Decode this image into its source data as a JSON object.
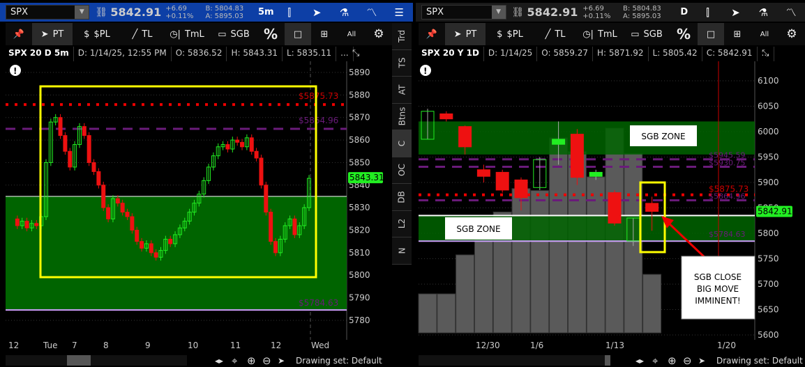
{
  "left": {
    "symbol": "SPX",
    "last": "5842.91",
    "change": "+6.69",
    "change_pct": "+0.11%",
    "bid": "B: 5804.83",
    "ask": "A: 5895.03",
    "timeframe": "5m",
    "tools": [
      "PT",
      "$PL",
      "TL",
      "TmL",
      "SGB",
      "%",
      "All"
    ],
    "info": [
      "SPX 20 D 5m",
      "D: 1/14/25, 12:55 PM",
      "O: 5836.52",
      "H: 5843.31",
      "L: 5835.11",
      "..."
    ],
    "side_tabs": [
      "Trd",
      "TS",
      "AT",
      "Btns",
      "C",
      "OC",
      "DB",
      "L2",
      "N"
    ],
    "price_ticks": [
      "5890",
      "5880",
      "5870",
      "5860",
      "5850",
      "5840",
      "5830",
      "5820",
      "5810",
      "5800",
      "5790",
      "5780"
    ],
    "price_tag": "5843.31",
    "levels": {
      "red": "$5875.73",
      "purple": "$5864.96",
      "low": "$5784.63"
    },
    "time_ticks": [
      "12",
      "Tue",
      "7",
      "8",
      "9",
      "10",
      "11",
      "12",
      "Wed"
    ],
    "drawing_set": "Drawing set: Default"
  },
  "right": {
    "symbol": "SPX",
    "last": "5842.91",
    "change": "+6.69",
    "change_pct": "+0.11%",
    "bid": "B: 5804.83",
    "ask": "A: 5895.03",
    "timeframe": "D",
    "tools": [
      "PT",
      "$PL",
      "TL",
      "TmL",
      "SGB",
      "%",
      "All"
    ],
    "info": [
      "SPX 20 Y 1D",
      "D: 1/14/25",
      "O: 5859.27",
      "H: 5871.92",
      "L: 5805.42",
      "C: 5842.91",
      "..."
    ],
    "price_ticks": [
      "6100",
      "6050",
      "6000",
      "5950",
      "5900",
      "5850",
      "5800",
      "5750",
      "5700",
      "5650",
      "5600"
    ],
    "price_tag": "5842.91",
    "levels": {
      "l1": "$5945.59",
      "l2": "$5930.75",
      "red": "$5875.73",
      "purple": "$5864.96",
      "low": "$5784.63"
    },
    "zone_upper": "SGB ZONE",
    "zone_lower": "SGB ZONE",
    "callout": "SGB CLOSE BIG MOVE IMMINENT!",
    "time_ticks": [
      "12/30",
      "1/6",
      "1/13",
      "1/20"
    ],
    "drawing_set": "Drawing set: Default"
  },
  "colors": {
    "up": "#22ee22",
    "down": "#ee1111",
    "zone": "#006400",
    "yellow": "#ffff00",
    "purple": "#6a1b7a"
  },
  "chart_data": [
    {
      "type": "candlestick",
      "title": "SPX 20 D 5m",
      "ylim": [
        5777,
        5895
      ],
      "closes": [
        5825,
        5822,
        5824,
        5821,
        5823,
        5822,
        5826,
        5850,
        5868,
        5870,
        5862,
        5855,
        5848,
        5858,
        5866,
        5862,
        5850,
        5846,
        5840,
        5830,
        5825,
        5834,
        5832,
        5828,
        5826,
        5820,
        5815,
        5812,
        5814,
        5810,
        5808,
        5811,
        5816,
        5814,
        5818,
        5821,
        5824,
        5828,
        5832,
        5836,
        5842,
        5848,
        5853,
        5857,
        5858,
        5856,
        5860,
        5859,
        5857,
        5861,
        5855,
        5852,
        5840,
        5828,
        5815,
        5810,
        5816,
        5822,
        5825,
        5818,
        5822,
        5830,
        5843
      ]
    },
    {
      "type": "candlestick",
      "title": "SPX 20 Y 1D",
      "ylim": [
        5590,
        6120
      ],
      "candles": [
        [
          5985,
          6045,
          5985,
          6040
        ],
        [
          6035,
          6040,
          6020,
          6025
        ],
        [
          6010,
          6012,
          5955,
          5970
        ],
        [
          5925,
          5935,
          5900,
          5912
        ],
        [
          5920,
          5925,
          5880,
          5885
        ],
        [
          5905,
          5910,
          5845,
          5870
        ],
        [
          5890,
          5950,
          5885,
          5945
        ],
        [
          5975,
          6020,
          5935,
          5985
        ],
        [
          5995,
          6005,
          5895,
          5910
        ],
        [
          5912,
          5925,
          5905,
          5920
        ],
        [
          5880,
          5885,
          5815,
          5820
        ],
        [
          5785,
          5830,
          5775,
          5830
        ],
        [
          5859,
          5872,
          5805,
          5843
        ]
      ],
      "volume": [
        0.2,
        0.2,
        0.4,
        0.55,
        0.62,
        0.74,
        0.73,
        1.0,
        0.93,
        0.8,
        1.05,
        0.92,
        0.3
      ]
    }
  ]
}
